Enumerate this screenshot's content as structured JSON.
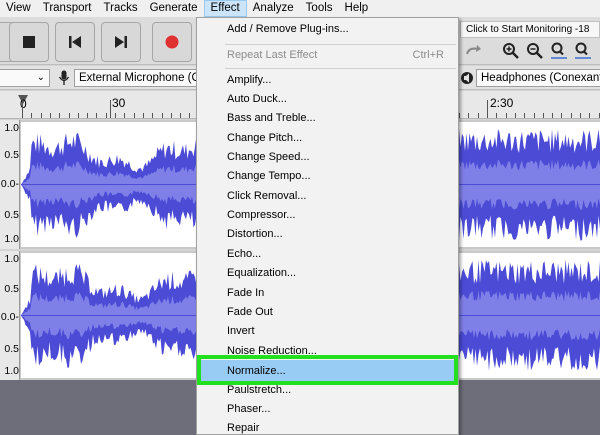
{
  "menubar": {
    "items": [
      "View",
      "Transport",
      "Tracks",
      "Generate",
      "Effect",
      "Analyze",
      "Tools",
      "Help"
    ],
    "active": "Effect"
  },
  "toolbar": {
    "stop_icon": "stop-icon",
    "skip_start_icon": "skip-to-start-icon",
    "skip_end_icon": "skip-to-end-icon",
    "record_icon": "record-icon",
    "monitor_text": "Click to Start Monitoring  -18",
    "record_color": "#e03030"
  },
  "devices": {
    "input_device": "External Microphone (C",
    "output_device": "Headphones (Conexant I"
  },
  "timeline": {
    "labels": [
      "0",
      "30",
      "2:30"
    ]
  },
  "tracks": {
    "scale_labels": [
      "1.0",
      "0.5",
      "0.0-",
      "0.5",
      "1.0"
    ],
    "wave_color": "#4b4bd6",
    "wave_inner_color": "#7f7fe8"
  },
  "effect_menu": {
    "items": [
      {
        "label": "Add / Remove Plug-ins...",
        "disabled": false
      },
      {
        "label": "Repeat Last Effect",
        "shortcut": "Ctrl+R",
        "disabled": true
      },
      {
        "label": "Amplify...",
        "disabled": false
      },
      {
        "label": "Auto Duck...",
        "disabled": false
      },
      {
        "label": "Bass and Treble...",
        "disabled": false
      },
      {
        "label": "Change Pitch...",
        "disabled": false
      },
      {
        "label": "Change Speed...",
        "disabled": false
      },
      {
        "label": "Change Tempo...",
        "disabled": false
      },
      {
        "label": "Click Removal...",
        "disabled": false
      },
      {
        "label": "Compressor...",
        "disabled": false
      },
      {
        "label": "Distortion...",
        "disabled": false
      },
      {
        "label": "Echo...",
        "disabled": false
      },
      {
        "label": "Equalization...",
        "disabled": false
      },
      {
        "label": "Fade In",
        "disabled": false
      },
      {
        "label": "Fade Out",
        "disabled": false
      },
      {
        "label": "Invert",
        "disabled": false
      },
      {
        "label": "Noise Reduction...",
        "disabled": false
      },
      {
        "label": "Normalize...",
        "disabled": false,
        "highlighted": true
      },
      {
        "label": "Paulstretch...",
        "disabled": false
      },
      {
        "label": "Phaser...",
        "disabled": false
      },
      {
        "label": "Repair",
        "disabled": false
      }
    ],
    "highlight_color": "#22e01e"
  }
}
